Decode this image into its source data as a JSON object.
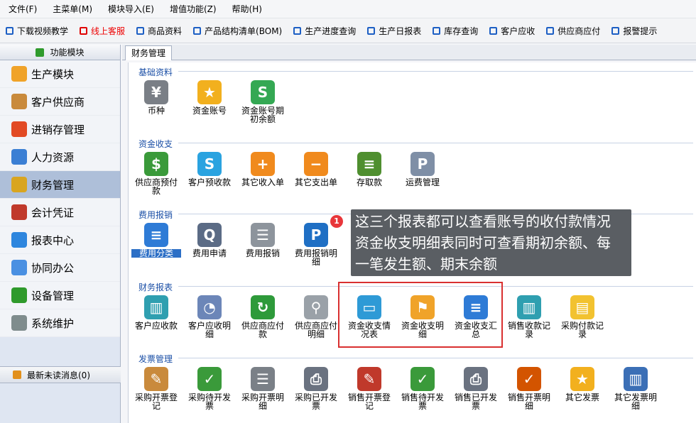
{
  "menubar": [
    "文件(F)",
    "主菜单(M)",
    "模块导入(E)",
    "增值功能(Z)",
    "帮助(H)"
  ],
  "toolbar": [
    {
      "label": "下载视频教学",
      "color": "#1d5fc4"
    },
    {
      "label": "线上客服",
      "color": "#e00000"
    },
    {
      "label": "商品资料",
      "color": "#1d5fc4"
    },
    {
      "label": "产品结构清单(BOM)",
      "color": "#1d5fc4"
    },
    {
      "label": "生产进度查询",
      "color": "#1d5fc4"
    },
    {
      "label": "生产日报表",
      "color": "#1d5fc4"
    },
    {
      "label": "库存查询",
      "color": "#1d5fc4"
    },
    {
      "label": "客户应收",
      "color": "#1d5fc4"
    },
    {
      "label": "供应商应付",
      "color": "#1d5fc4"
    },
    {
      "label": "报警提示",
      "color": "#1d5fc4"
    }
  ],
  "sidebar": {
    "header": "功能模块",
    "items": [
      {
        "label": "生产模块",
        "icon": "folder-icon",
        "color": "#f0a329"
      },
      {
        "label": "客户供应商",
        "icon": "users-icon",
        "color": "#c98a3c"
      },
      {
        "label": "进销存管理",
        "icon": "bar-chart-icon",
        "color": "#e24a24"
      },
      {
        "label": "人力资源",
        "icon": "person-icon",
        "color": "#3b7fd4"
      },
      {
        "label": "财务管理",
        "icon": "coins-icon",
        "color": "#d9a520"
      },
      {
        "label": "会计凭证",
        "icon": "book-icon",
        "color": "#c0392b"
      },
      {
        "label": "报表中心",
        "icon": "report-icon",
        "color": "#2e86de"
      },
      {
        "label": "协同办公",
        "icon": "calendar-icon",
        "color": "#4a90e2"
      },
      {
        "label": "设备管理",
        "icon": "grid-icon",
        "color": "#2f9a2c"
      },
      {
        "label": "系统维护",
        "icon": "lock-icon",
        "color": "#7f8c8d"
      }
    ],
    "active_index": 4,
    "unread": "最新未读消息(0)"
  },
  "tab": "财务管理",
  "sections": [
    {
      "title": "基础资料",
      "items": [
        {
          "label": "币种",
          "icon": "yen-icon",
          "color": "#7a7f86",
          "glyph": "¥"
        },
        {
          "label": "资金账号",
          "icon": "star-icon",
          "color": "#f2b01e",
          "glyph": "★"
        },
        {
          "label": "资金账号期初余额",
          "icon": "dollar-icon",
          "color": "#34a853",
          "glyph": "S"
        }
      ]
    },
    {
      "title": "资金收支",
      "items": [
        {
          "label": "供应商预付款",
          "icon": "money-bag-icon",
          "color": "#3a9a3a",
          "glyph": "$"
        },
        {
          "label": "客户预收款",
          "icon": "skype-icon",
          "color": "#2aa3e0",
          "glyph": "S"
        },
        {
          "label": "其它收入单",
          "icon": "rss-add-icon",
          "color": "#f08a1d",
          "glyph": "+"
        },
        {
          "label": "其它支出单",
          "icon": "rss-minus-icon",
          "color": "#f08a1d",
          "glyph": "−"
        },
        {
          "label": "存取款",
          "icon": "cash-icon",
          "color": "#4f8f2f",
          "glyph": "≡"
        },
        {
          "label": "运费管理",
          "icon": "p-icon",
          "color": "#7f8fa6",
          "glyph": "P"
        }
      ]
    },
    {
      "title": "费用报销",
      "items": [
        {
          "label": "费用分类",
          "icon": "database-icon",
          "color": "#2e7bd6",
          "glyph": "≡",
          "selected": true
        },
        {
          "label": "费用申请",
          "icon": "search-person-icon",
          "color": "#5b6b85",
          "glyph": "Q"
        },
        {
          "label": "费用报销",
          "icon": "documents-icon",
          "color": "#8d949c",
          "glyph": "☰"
        },
        {
          "label": "费用报销明细",
          "icon": "p-blue-icon",
          "color": "#1f6fc4",
          "glyph": "P"
        }
      ]
    },
    {
      "title": "财务报表",
      "items": [
        {
          "label": "客户应收款",
          "icon": "map-icon",
          "color": "#2f9fb0",
          "glyph": "▥"
        },
        {
          "label": "客户应收明细",
          "icon": "gauge-icon",
          "color": "#6c86b8",
          "glyph": "◔"
        },
        {
          "label": "供应商应付款",
          "icon": "refresh-icon",
          "color": "#2e9a3a",
          "glyph": "↻"
        },
        {
          "label": "供应商应付明细",
          "icon": "magnifier-icon",
          "color": "#9aa1a8",
          "glyph": "⚲"
        },
        {
          "label": "资金收支情况表",
          "icon": "credit-card-icon",
          "color": "#2e9ad6",
          "glyph": "▭"
        },
        {
          "label": "资金收支明细",
          "icon": "map-pin-icon",
          "color": "#f0a329",
          "glyph": "⚑"
        },
        {
          "label": "资金收支汇总",
          "icon": "server-icon",
          "color": "#2e7bd6",
          "glyph": "≡"
        },
        {
          "label": "销售收款记录",
          "icon": "map-icon",
          "color": "#2f9fb0",
          "glyph": "▥"
        },
        {
          "label": "采购付款记录",
          "icon": "folder-doc-icon",
          "color": "#f2c230",
          "glyph": "▤"
        }
      ]
    },
    {
      "title": "发票管理",
      "items": [
        {
          "label": "采购开票登记",
          "icon": "edit-doc-icon",
          "color": "#c98a3c",
          "glyph": "✎"
        },
        {
          "label": "采购待开发票",
          "icon": "chart-check-icon",
          "color": "#3a9a3a",
          "glyph": "✓"
        },
        {
          "label": "采购开票明细",
          "icon": "ledger-icon",
          "color": "#7a8087",
          "glyph": "☰"
        },
        {
          "label": "采购已开发票",
          "icon": "printer-icon",
          "color": "#6a7280",
          "glyph": "⎙"
        },
        {
          "label": "销售开票登记",
          "icon": "pencil-book-icon",
          "color": "#c0392b",
          "glyph": "✎"
        },
        {
          "label": "销售待开发票",
          "icon": "calculator-check-icon",
          "color": "#3a9a3a",
          "glyph": "✓"
        },
        {
          "label": "销售已开发票",
          "icon": "printer-check-icon",
          "color": "#6a7280",
          "glyph": "⎙"
        },
        {
          "label": "销售开票明细",
          "icon": "bars-check-icon",
          "color": "#d35400",
          "glyph": "✓"
        },
        {
          "label": "其它发票",
          "icon": "star-icon",
          "color": "#f2b01e",
          "glyph": "★"
        },
        {
          "label": "其它发票明细",
          "icon": "books-icon",
          "color": "#3b6fb6",
          "glyph": "▥"
        }
      ]
    }
  ],
  "callout": {
    "badge": "1",
    "lines": [
      "这三个报表都可以查看账号的收付款情况",
      "资金收支明细表同时可查看期初余额、每",
      "一笔发生额、期末余额"
    ]
  }
}
